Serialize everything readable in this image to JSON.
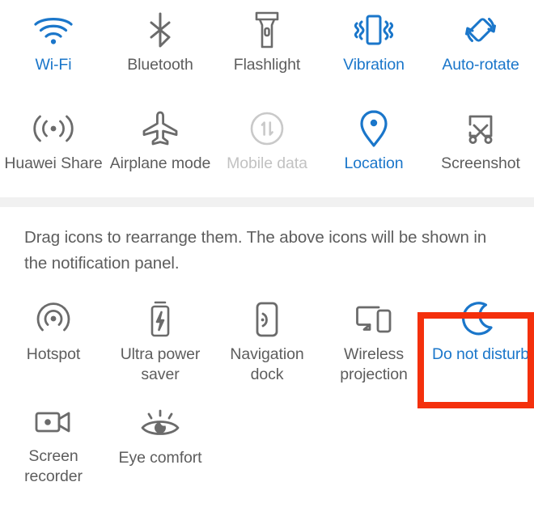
{
  "screen": {
    "title": "Shortcuts / Quick settings editor",
    "colors": {
      "accent_blue": "#1a76ca",
      "icon_gray": "#6b6b6b",
      "label_gray": "#5d5d5d",
      "disabled_gray": "#c2c2c2",
      "highlight_red": "#f4300c",
      "separator_gray": "#f1f1f1",
      "background": "#ffffff"
    }
  },
  "top_section": {
    "rows": [
      {
        "tiles": [
          {
            "label": "Wi-Fi",
            "icon": "wifi-icon",
            "state": "active"
          },
          {
            "label": "Bluetooth",
            "icon": "bluetooth-icon",
            "state": "inactive"
          },
          {
            "label": "Flashlight",
            "icon": "flashlight-icon",
            "state": "inactive"
          },
          {
            "label": "Vibration",
            "icon": "vibration-icon",
            "state": "active"
          },
          {
            "label": "Auto-rotate",
            "icon": "auto-rotate-icon",
            "state": "active"
          }
        ]
      },
      {
        "tiles": [
          {
            "label": "Huawei Share",
            "icon": "huawei-share-icon",
            "state": "inactive"
          },
          {
            "label": "Airplane mode",
            "icon": "airplane-icon",
            "state": "inactive"
          },
          {
            "label": "Mobile data",
            "icon": "mobile-data-icon",
            "state": "disabled"
          },
          {
            "label": "Location",
            "icon": "location-pin-icon",
            "state": "active"
          },
          {
            "label": "Screenshot",
            "icon": "screenshot-icon",
            "state": "inactive"
          }
        ]
      }
    ]
  },
  "hint": {
    "text": "Drag icons to rearrange them. The above icons will be shown in the notification panel."
  },
  "bottom_section": {
    "rows": [
      {
        "tiles": [
          {
            "label": "Hotspot",
            "icon": "hotspot-icon",
            "state": "inactive"
          },
          {
            "label": "Ultra power saver",
            "icon": "ultra-power-saver-icon",
            "state": "inactive"
          },
          {
            "label": "Navigation dock",
            "icon": "navigation-dock-icon",
            "state": "inactive"
          },
          {
            "label": "Wireless projection",
            "icon": "wireless-projection-icon",
            "state": "inactive"
          },
          {
            "label": "Do not disturb",
            "icon": "moon-icon",
            "state": "active",
            "highlighted": true
          }
        ]
      },
      {
        "tiles": [
          {
            "label": "Screen recorder",
            "icon": "screen-recorder-icon",
            "state": "inactive"
          },
          {
            "label": "Eye comfort",
            "icon": "eye-comfort-icon",
            "state": "inactive"
          }
        ]
      }
    ]
  }
}
